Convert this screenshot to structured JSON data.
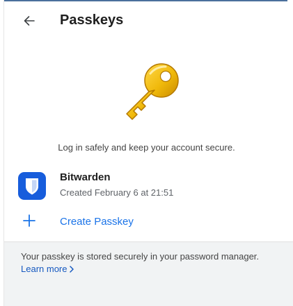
{
  "header": {
    "title": "Passkeys",
    "back_icon": "arrow-left-icon"
  },
  "hero": {
    "icon": "key-icon",
    "tagline": "Log in safely and keep your account secure."
  },
  "passkeys": [
    {
      "name": "Bitwarden",
      "created": "Created February 6 at 21:51",
      "icon": "bitwarden-shield-icon",
      "icon_color": "#175DDC"
    }
  ],
  "actions": {
    "create_label": "Create Passkey",
    "create_icon": "plus-icon",
    "accent_color": "#1A73E8"
  },
  "footer": {
    "note": "Your passkey is stored securely in your password manager.",
    "learn_more": "Learn more"
  },
  "colors": {
    "key_gold": "#E8B007",
    "footer_bg": "#F1F3F4"
  }
}
